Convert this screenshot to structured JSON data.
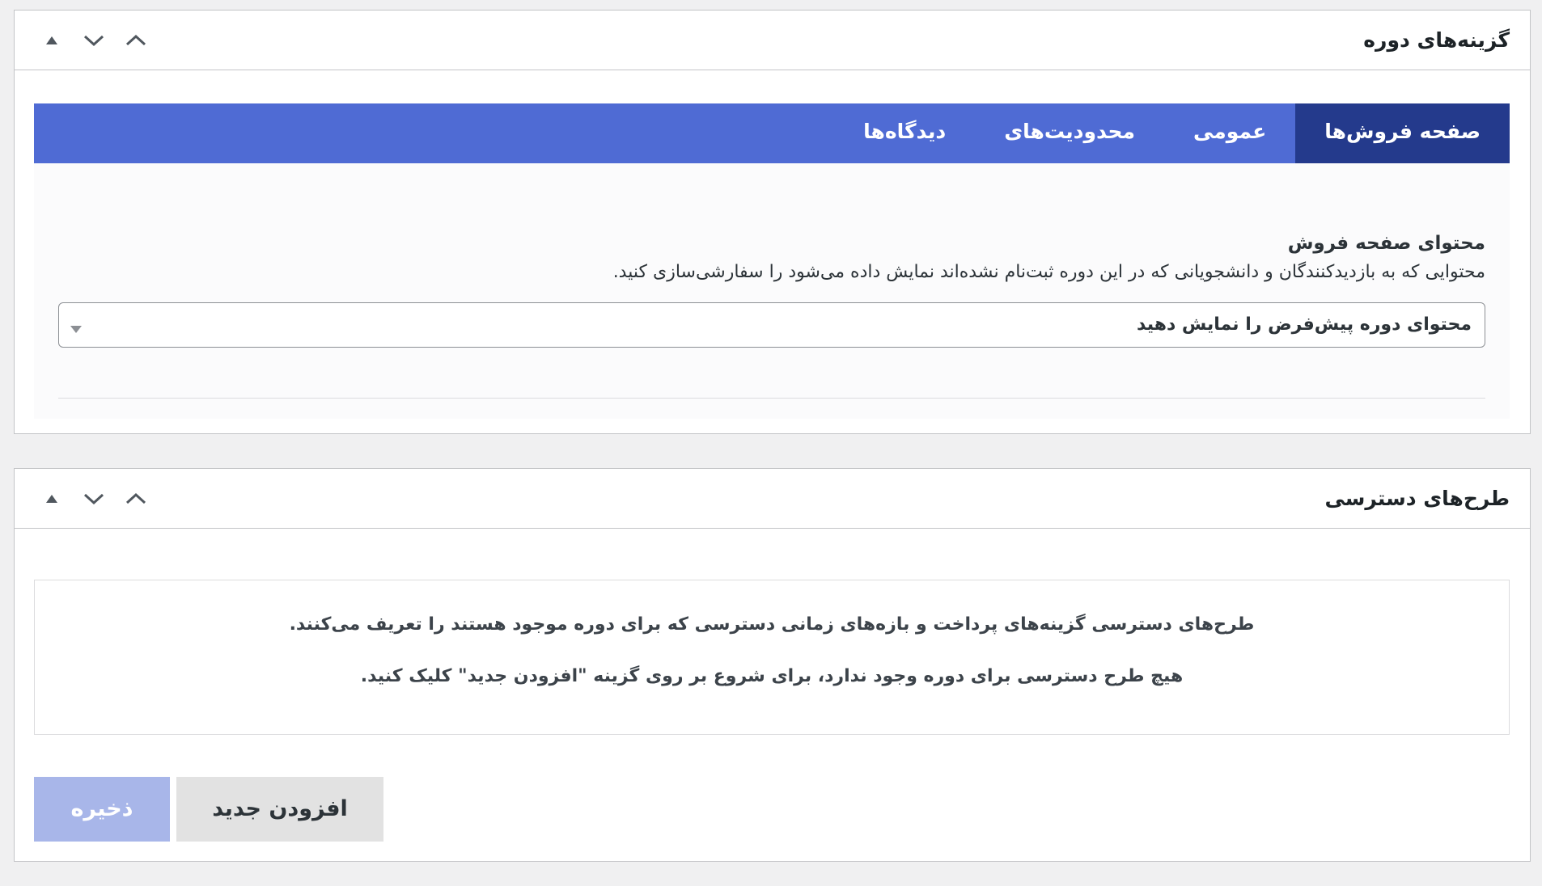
{
  "course_options": {
    "title": "گزینه‌های دوره",
    "tabs": [
      {
        "label": "صفحه فروش‌ها",
        "active": true
      },
      {
        "label": "عمومی",
        "active": false
      },
      {
        "label": "محدودیت‌های",
        "active": false
      },
      {
        "label": "دیدگاه‌ها",
        "active": false
      }
    ],
    "sales_page": {
      "label": "محتوای صفحه فروش",
      "description": "محتوایی که به بازدیدکنندگان و دانشجویانی که در این دوره ثبت‌نام نشده‌اند نمایش داده می‌شود را سفارشی‌سازی کنید.",
      "select_value": "محتوای دوره پیش‌فرض را نمایش دهید"
    }
  },
  "access_plans": {
    "title": "طرح‌های دسترسی",
    "description": "طرح‌های دسترسی گزینه‌های پرداخت و بازه‌های زمانی دسترسی که برای دوره موجود هستند را تعریف می‌کنند.",
    "empty_message": "هیچ طرح دسترسی برای دوره وجود ندارد، برای شروع بر روی گزینه \"افزودن جدید\" کلیک کنید.",
    "add_button": "افزودن جدید",
    "save_button": "ذخیره"
  },
  "icons": {
    "panel_controls": [
      "triangle-up-icon",
      "chevron-down-icon",
      "chevron-up-icon"
    ],
    "select_arrow": "triangle-down-icon"
  },
  "colors": {
    "tab_bar": "#4f6bd4",
    "tab_active": "#243a8c",
    "save_button_disabled": "#a8b6e9",
    "add_button": "#e2e2e2"
  }
}
